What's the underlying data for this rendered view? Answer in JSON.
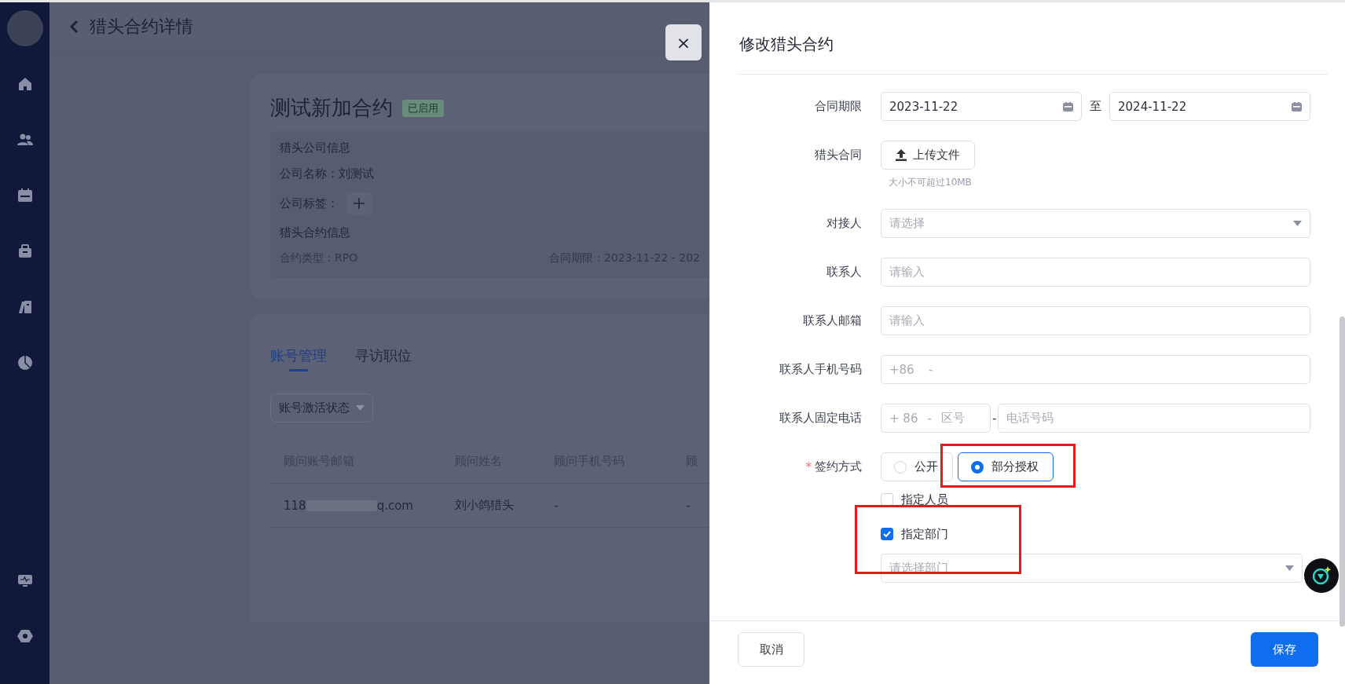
{
  "header": {
    "title": "猎头合约详情"
  },
  "close_button": "×",
  "contract_card": {
    "title": "测试新加合约",
    "status": "已启用",
    "company_section": {
      "heading": "猎头公司信息",
      "name_label": "公司名称：",
      "name": "刘测试",
      "tags_label": "公司标签："
    },
    "contract_section": {
      "heading": "猎头合约信息",
      "type": "合约类型：RPO",
      "period": "合同期限：2023-11-22 - 202"
    }
  },
  "tabs": [
    {
      "label": "账号管理",
      "selected": true
    },
    {
      "label": "寻访职位",
      "selected": false
    }
  ],
  "filter": {
    "label": "账号激活状态"
  },
  "table": {
    "columns": [
      "顾问账号邮箱",
      "顾问姓名",
      "顾问手机号码",
      "顾"
    ],
    "rows": [
      {
        "email_start": "118",
        "email_end": "q.com",
        "name": "刘小鸽猎头",
        "phone": "-",
        "column_4": "-"
      }
    ]
  },
  "drawer": {
    "title": "修改猎头合约",
    "fields": [
      {
        "kind": "date_range",
        "label": "合同期限",
        "start": "2023-11-22",
        "separator": "至",
        "end": "2024-11-22"
      },
      {
        "kind": "upload",
        "label": "猎头合同",
        "button": "上传文件",
        "hint": "大小不可超过10MB"
      },
      {
        "kind": "select",
        "label": "对接人",
        "placeholder": "请选择"
      },
      {
        "kind": "input",
        "label": "联系人",
        "placeholder": "请输入"
      },
      {
        "kind": "input",
        "label": "联系人邮箱",
        "placeholder": "请输入"
      },
      {
        "kind": "phone",
        "label": "联系人手机号码",
        "prefix": "+86",
        "separator": "-"
      },
      {
        "kind": "landline",
        "label": "联系人固定电话",
        "prefix": "+ 86",
        "separator": "-",
        "area_placeholder": "区号",
        "joiner": "-",
        "number_placeholder": "电话号码"
      },
      {
        "kind": "radio",
        "label": "签约方式",
        "required_mark": "*",
        "options": [
          {
            "label": "公开",
            "selected": false
          },
          {
            "label": "部分授权",
            "selected": true
          }
        ]
      },
      {
        "kind": "checkbox",
        "label": "指定人员",
        "checked": false
      },
      {
        "kind": "checkbox",
        "label": "指定部门",
        "checked": true
      },
      {
        "kind": "select",
        "placeholder": "请选择部门"
      }
    ]
  },
  "footer": {
    "cancel": "取消",
    "save": "保存"
  }
}
